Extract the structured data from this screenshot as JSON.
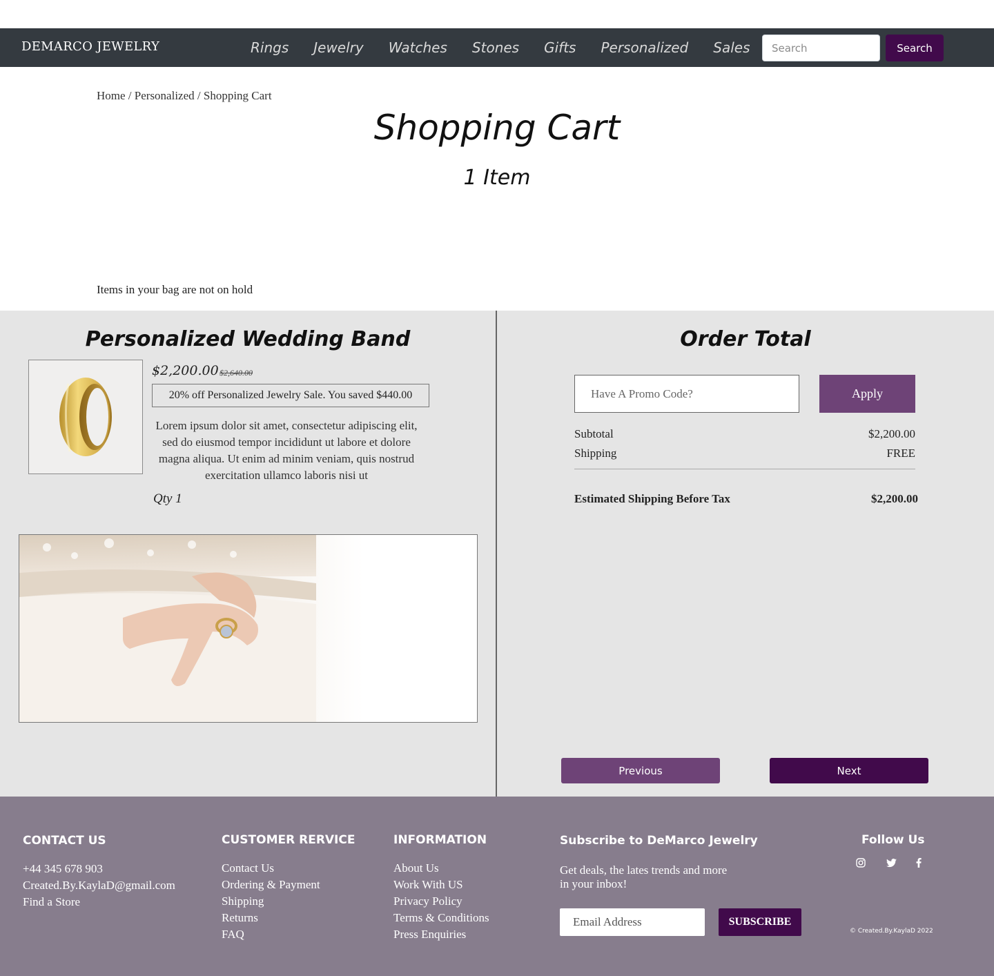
{
  "nav": {
    "brand": "DEMARCO JEWELRY",
    "links": [
      "Rings",
      "Jewelry",
      "Watches",
      "Stones",
      "Gifts",
      "Personalized",
      "Sales"
    ],
    "search_placeholder": "Search",
    "search_button": "Search"
  },
  "breadcrumb": {
    "home": "Home",
    "sep": "/",
    "section": "Personalized",
    "current": "Shopping Cart"
  },
  "page": {
    "title": "Shopping Cart",
    "item_count": "1 Item",
    "hold_note": "Items in your bag are not on hold"
  },
  "product": {
    "title": "Personalized Wedding Band",
    "price": "$2,200.00",
    "original_price": "$2,640.00",
    "sale_note": "20% off Personalized Jewelry Sale. You saved $440.00",
    "description": "Lorem ipsum dolor sit amet, consectetur adipiscing elit, sed do eiusmod tempor incididunt ut labore et dolore magna aliqua. Ut enim ad minim veniam, quis nostrud exercitation ullamco laboris nisi ut",
    "qty": "Qty 1"
  },
  "order": {
    "title": "Order Total",
    "promo_placeholder": "Have A Promo Code?",
    "apply_button": "Apply",
    "subtotal_label": "Subtotal",
    "subtotal_value": "$2,200.00",
    "shipping_label": "Shipping",
    "shipping_value": "FREE",
    "total_label": "Estimated Shipping Before Tax",
    "total_value": "$2,200.00",
    "prev_button": "Previous",
    "next_button": "Next"
  },
  "footer": {
    "contact": {
      "heading": "CONTACT US",
      "items": [
        "+44 345 678 903",
        "Created.By.KaylaD@gmail.com",
        "Find a Store"
      ]
    },
    "customer": {
      "heading": "CUSTOMER RERVICE",
      "items": [
        "Contact Us",
        "Ordering & Payment",
        "Shipping",
        "Returns",
        "FAQ"
      ]
    },
    "information": {
      "heading": "INFORMATION",
      "items": [
        "About Us",
        "Work With US",
        "Privacy Policy",
        "Terms & Conditions",
        "Press Enquiries"
      ]
    },
    "subscribe": {
      "heading": "Subscribe to DeMarco Jewelry",
      "text": "Get deals, the lates trends and more in your inbox!",
      "email_placeholder": "Email Address",
      "button": "SUBSCRIBE"
    },
    "follow": {
      "heading": "Follow Us",
      "icons": [
        "instagram-icon",
        "twitter-icon",
        "facebook-icon"
      ]
    },
    "copyright": "© Created.By.KaylaD 2022"
  },
  "colors": {
    "nav_bg": "#343a40",
    "brand_purple": "#410a4b",
    "accent_purple": "#6e4377",
    "cart_bg": "#e5e5e5",
    "footer_bg": "#877d8d"
  }
}
